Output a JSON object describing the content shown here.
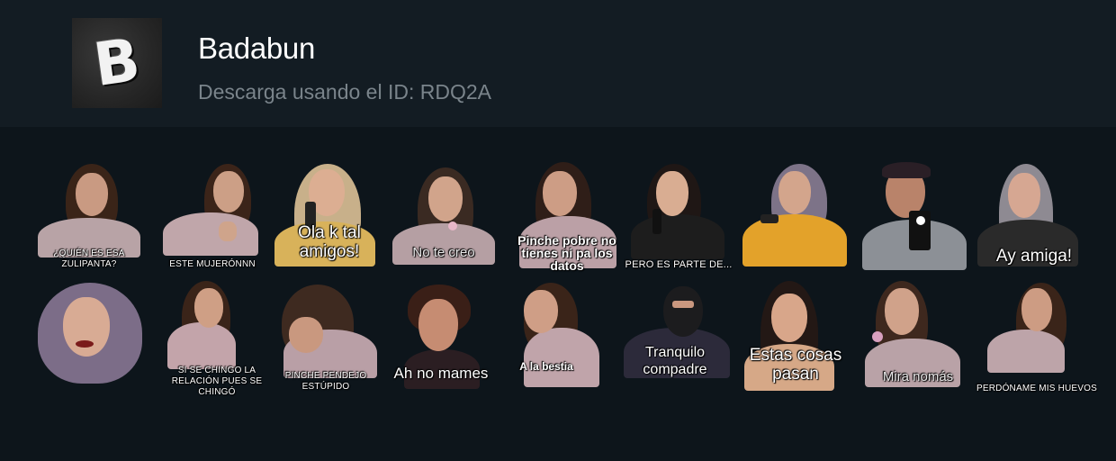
{
  "header": {
    "title": "Badabun",
    "subtitle": "Descarga usando el ID: RDQ2A",
    "logo_letter": "B"
  },
  "stickers": [
    {
      "caption": "¿QUIÉN ES ESA ZULIPANTA?"
    },
    {
      "caption": "ESTE MUJERÓNNN"
    },
    {
      "caption": "Ola k tal amigos!"
    },
    {
      "caption": "No te creo"
    },
    {
      "caption": "Pinche pobre no tienes ni pa los datos"
    },
    {
      "caption": "PERO ES PARTE DE..."
    },
    {
      "caption": ""
    },
    {
      "caption": ""
    },
    {
      "caption": "Ay amiga!"
    },
    {
      "caption": ""
    },
    {
      "caption": "SI SE CHINGO LA RELACIÓN PUES SE CHINGÓ"
    },
    {
      "caption": "PINCHE PENDEJO ESTÚPIDO"
    },
    {
      "caption": "Ah no mames"
    },
    {
      "caption": "A la bestia"
    },
    {
      "caption": "Tranquilo compadre"
    },
    {
      "caption": "Estas cosas pasan"
    },
    {
      "caption": "Mira nomás"
    },
    {
      "caption": "PERDÓNAME MIS HUEVOS"
    }
  ],
  "colors": {
    "header_bg": "#131c23",
    "page_bg": "#0d151b",
    "title": "#ffffff",
    "subtitle": "#7a848b"
  }
}
